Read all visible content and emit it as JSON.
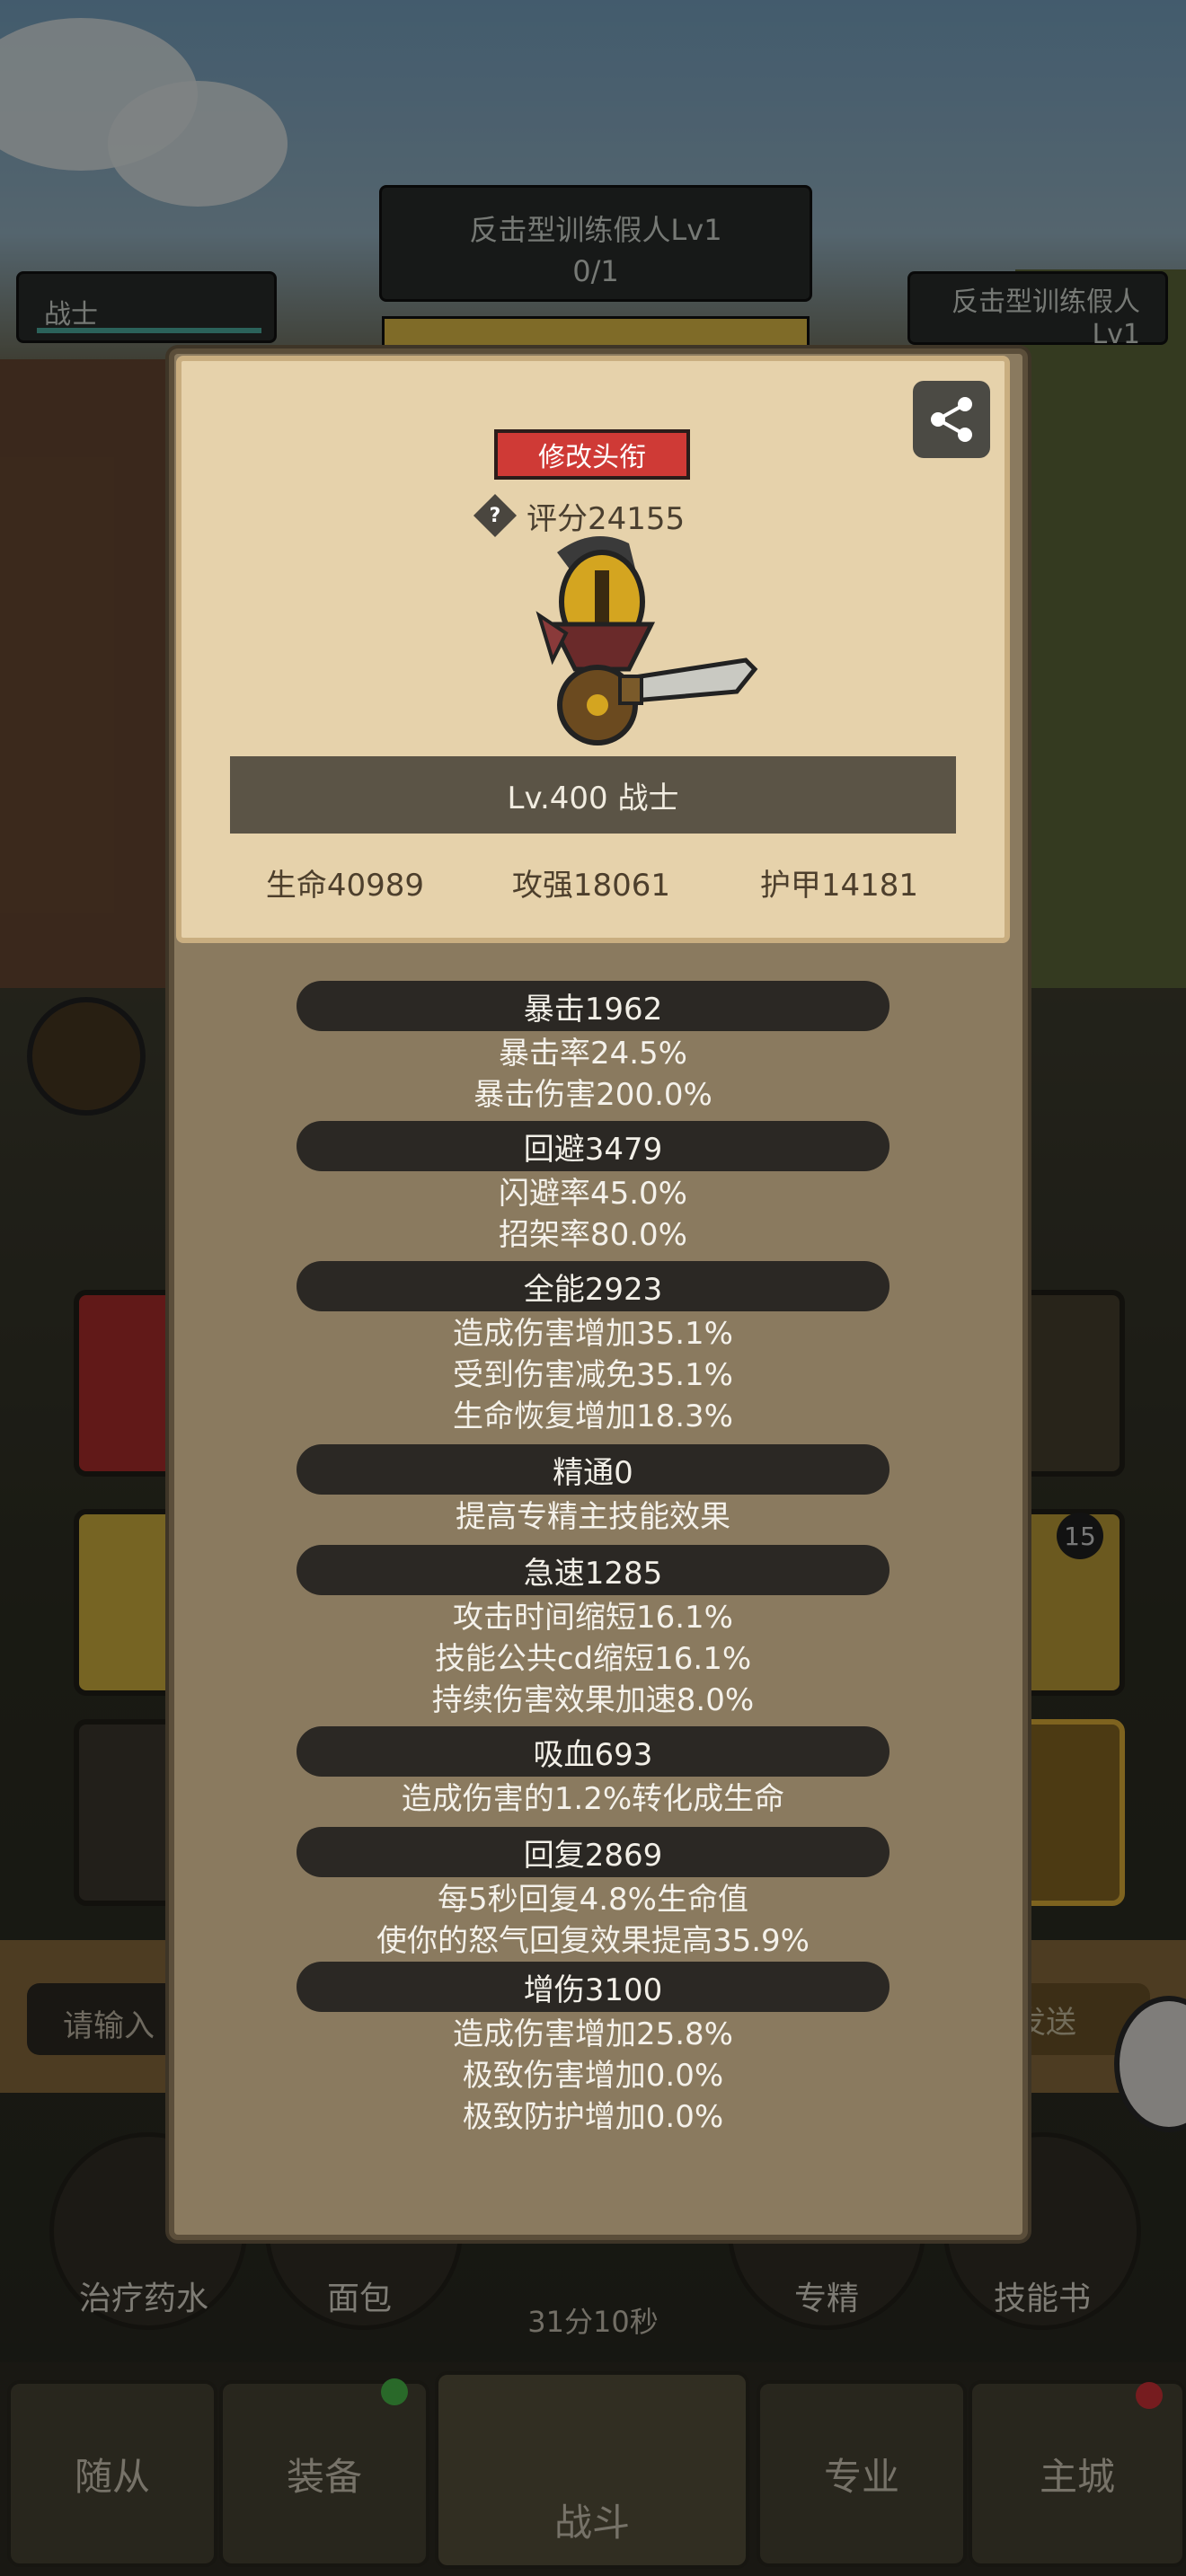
{
  "background_hud": {
    "player_class_label": "战士",
    "enemy_name_top": "反击型训练假人Lv1",
    "enemy_progress": "0/1",
    "enemy_name_right_line1": "反击型训练假人",
    "enemy_name_right_line2": "Lv1",
    "chat_placeholder": "请输入",
    "send_label": "发送",
    "skill_badge": "15",
    "items": [
      {
        "label": "治疗药水"
      },
      {
        "label": "面包"
      },
      {
        "label": "专精"
      },
      {
        "label": "技能书"
      }
    ],
    "timer": "31分10秒"
  },
  "bottom_nav": {
    "tabs": [
      {
        "label": "随从"
      },
      {
        "label": "装备"
      },
      {
        "label": "战斗"
      },
      {
        "label": "专业"
      },
      {
        "label": "主城"
      }
    ]
  },
  "dialog": {
    "edit_title_button": "修改头衔",
    "score": "评分24155",
    "level_class": "Lv.400 战士",
    "base_stats": {
      "hp": "生命40989",
      "attack": "攻强18061",
      "armor": "护甲14181"
    },
    "sections": [
      {
        "header": "暴击1962",
        "lines": [
          "暴击率24.5%",
          "暴击伤害200.0%"
        ]
      },
      {
        "header": "回避3479",
        "lines": [
          "闪避率45.0%",
          "招架率80.0%"
        ]
      },
      {
        "header": "全能2923",
        "lines": [
          "造成伤害增加35.1%",
          "受到伤害减免35.1%",
          "生命恢复增加18.3%"
        ]
      },
      {
        "header": "精通0",
        "lines": [
          "提高专精主技能效果"
        ]
      },
      {
        "header": "急速1285",
        "lines": [
          "攻击时间缩短16.1%",
          "技能公共cd缩短16.1%",
          "持续伤害效果加速8.0%"
        ]
      },
      {
        "header": "吸血693",
        "lines": [
          "造成伤害的1.2%转化成生命"
        ]
      },
      {
        "header": "回复2869",
        "lines": [
          "每5秒回复4.8%生命值",
          "使你的怒气回复效果提高35.9%"
        ]
      },
      {
        "header": "增伤3100",
        "lines": [
          "造成伤害增加25.8%",
          "极致伤害增加0.0%",
          "极致防护增加0.0%"
        ]
      }
    ]
  },
  "colors": {
    "title_button_red": "#cf3a36",
    "card_parchment": "#e6d2ab",
    "panel_brown": "#8a7a5f",
    "section_bar": "#2b2824"
  }
}
